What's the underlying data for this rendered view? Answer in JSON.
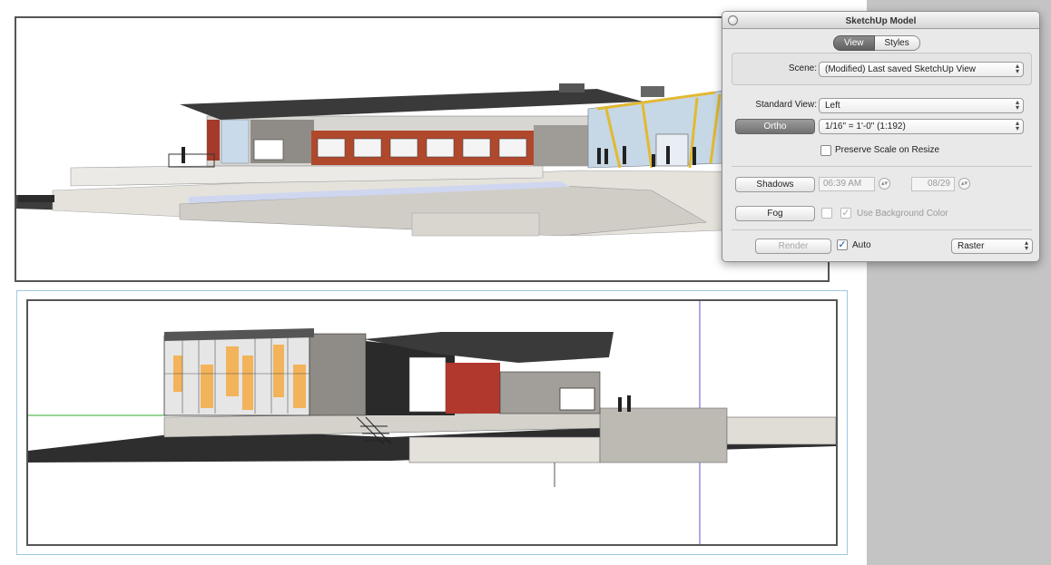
{
  "panel": {
    "title": "SketchUp Model",
    "tabs": [
      {
        "label": "View",
        "active": true
      },
      {
        "label": "Styles",
        "active": false
      }
    ],
    "scene": {
      "label": "Scene:",
      "value": "(Modified) Last saved SketchUp View"
    },
    "standard_view": {
      "label": "Standard View:",
      "value": "Left"
    },
    "ortho": {
      "label": "Ortho",
      "scale_value": "1/16\" = 1'-0\" (1:192)"
    },
    "preserve_scale": {
      "label": "Preserve Scale on Resize",
      "checked": false
    },
    "shadows": {
      "label": "Shadows",
      "time": "06:39 AM",
      "date": "08/29"
    },
    "fog": {
      "label": "Fog",
      "checked": false,
      "use_bg_label": "Use Background Color",
      "use_bg_checked": true
    },
    "render": {
      "label": "Render",
      "auto_label": "Auto",
      "auto_checked": true,
      "mode": "Raster"
    }
  },
  "colors": {
    "accent_dark_button": "#7a7a7a",
    "roof": "#3a3a3a",
    "brick": "#b0382c",
    "wood_panel": "#f2b35a",
    "glass": "#cfe0f0",
    "ground_line": "#33aa33",
    "section_plane": "#7d6fe0",
    "viewport_border": "#555555",
    "frame_highlight": "#9cc9e0"
  }
}
